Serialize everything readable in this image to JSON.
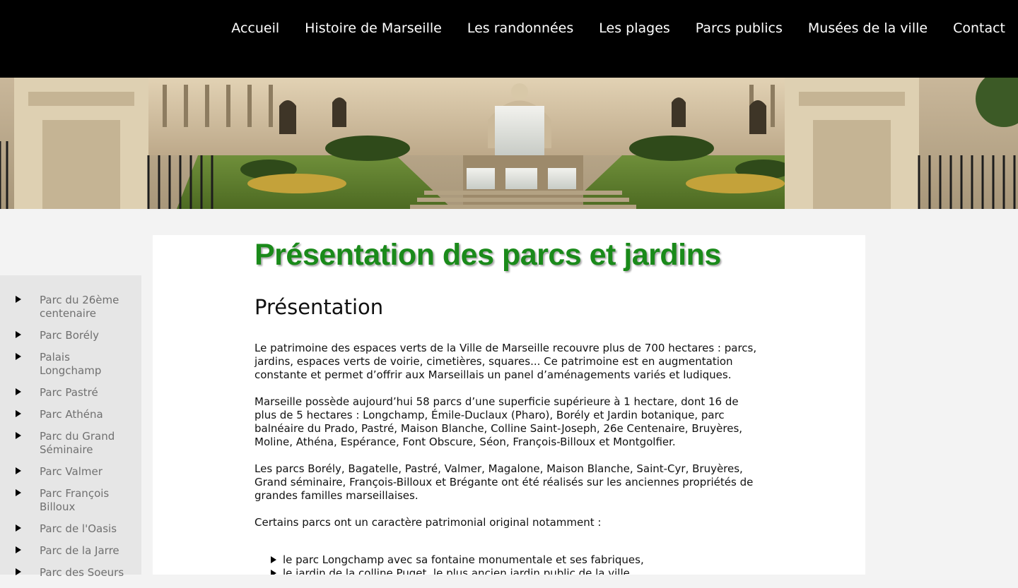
{
  "colors": {
    "nav_background": "#000000",
    "title_green": "#1a8a1a",
    "sidebar_background": "#e6e6e6",
    "page_background": "#f3f3f3"
  },
  "nav": {
    "items": [
      {
        "label": "Accueil"
      },
      {
        "label": "Histoire de Marseille"
      },
      {
        "label": "Les randonnées"
      },
      {
        "label": "Les plages"
      },
      {
        "label": "Parcs publics"
      },
      {
        "label": "Musées de la ville"
      },
      {
        "label": "Contact"
      }
    ]
  },
  "hero": {
    "image": "palais-longchamp-fountain-photo"
  },
  "sidebar": {
    "items": [
      {
        "label": "Parc du 26ème centenaire"
      },
      {
        "label": "Parc Borély"
      },
      {
        "label": "Palais Longchamp"
      },
      {
        "label": "Parc Pastré"
      },
      {
        "label": "Parc Athéna"
      },
      {
        "label": "Parc du Grand Séminaire"
      },
      {
        "label": "Parc Valmer"
      },
      {
        "label": "Parc François Billoux"
      },
      {
        "label": "Parc de l'Oasis"
      },
      {
        "label": "Parc de la Jarre"
      },
      {
        "label": "Parc des Soeurs"
      }
    ]
  },
  "main": {
    "title": "Présentation des parcs et jardins",
    "section_title": "Présentation",
    "paragraphs": [
      "Le patrimoine des espaces verts de la Ville de Marseille recouvre plus de 700 hectares : parcs, jardins, espaces verts de voirie, cimetières, squares... Ce patrimoine est en augmentation constante et permet d’offrir aux Marseillais un panel d’aménagements variés et ludiques.",
      "Marseille possède aujourd’hui 58 parcs d’une superficie supérieure à 1 hectare, dont 16 de plus de 5 hectares : Longchamp, Émile-Duclaux (Pharo), Borély et Jardin botanique, parc balnéaire du Prado, Pastré, Maison Blanche, Colline Saint-Joseph, 26e Centenaire, Bruyères, Moline, Athéna, Espérance, Font Obscure, Séon, François-Billoux et Montgolfier.",
      "Les parcs Borély, Bagatelle, Pastré, Valmer, Magalone, Maison Blanche, Saint-Cyr, Bruyères, Grand séminaire, François-Billoux et Brégante ont été réalisés sur les anciennes propriétés de grandes familles marseillaises.",
      "Certains parcs ont un caractère patrimonial original notamment :"
    ],
    "bullets": [
      "le parc Longchamp avec sa fontaine monumentale et ses fabriques,",
      "le jardin de la colline Puget, le plus ancien jardin public de la ville"
    ]
  }
}
